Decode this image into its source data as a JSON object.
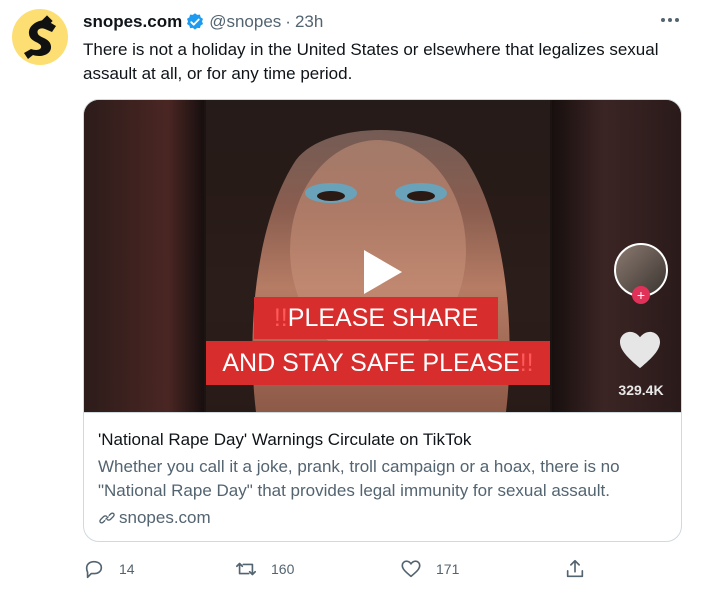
{
  "tweet": {
    "display_name": "snopes.com",
    "handle": "@snopes",
    "separator": "·",
    "time": "23h",
    "text": "There is not a holiday in the United States or elsewhere that legalizes sexual assault at all, or for any time period."
  },
  "media": {
    "banner_line1": "PLEASE SHARE",
    "banner_line2": "AND STAY SAFE PLEASE",
    "bang": "!!",
    "side_like_count": "329.4K",
    "side_plus": "+"
  },
  "card": {
    "title": "'National Rape Day' Warnings Circulate on TikTok",
    "description": "Whether you call it a joke, prank, troll campaign or a hoax, there is no \"National Rape Day\" that provides legal immunity for sexual assault.",
    "domain": "snopes.com"
  },
  "actions": {
    "replies": "14",
    "retweets": "160",
    "likes": "171"
  },
  "icons": {
    "verified": "verified-badge-icon",
    "more": "more-icon",
    "play": "play-icon",
    "link": "link-icon",
    "reply": "reply-icon",
    "retweet": "retweet-icon",
    "like": "heart-icon",
    "share": "share-icon"
  },
  "colors": {
    "accent": "#1d9bf0",
    "secondary_text": "#536471",
    "banner": "#d82d2d",
    "avatar_bg": "#fcde73"
  }
}
